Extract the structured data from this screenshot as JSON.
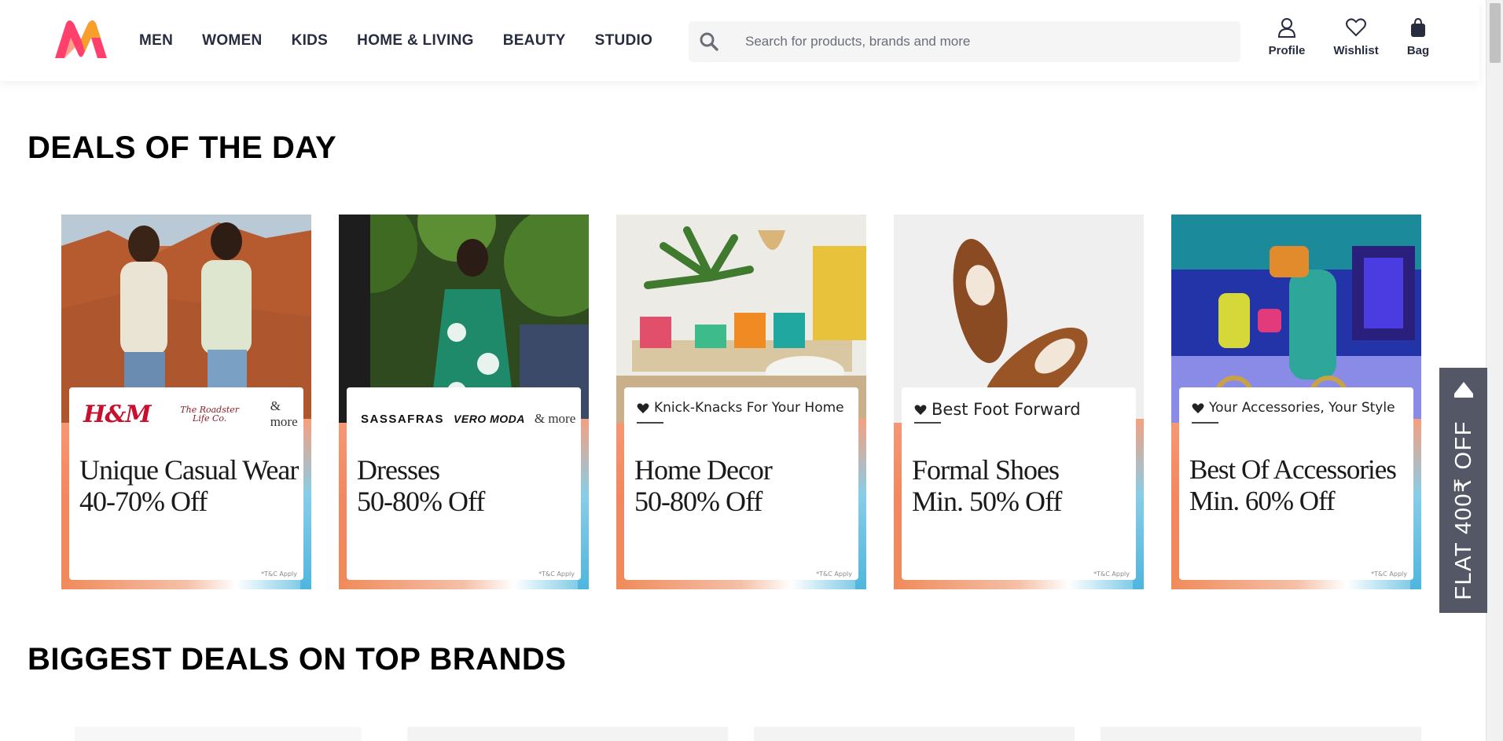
{
  "header": {
    "nav": [
      "MEN",
      "WOMEN",
      "KIDS",
      "HOME & LIVING",
      "BEAUTY",
      "STUDIO"
    ],
    "search_placeholder": "Search for products, brands and more",
    "actions": {
      "profile": "Profile",
      "wishlist": "Wishlist",
      "bag": "Bag"
    },
    "colors": {
      "logo_pink": "#ff3f6c",
      "logo_orange": "#f89f2b"
    }
  },
  "sections": {
    "deals_title": "DEALS OF THE DAY",
    "brands_title": "BIGGEST DEALS ON TOP BRANDS"
  },
  "deals": [
    {
      "brands": [
        "H&M",
        "The Roadster Life Co.",
        "& more"
      ],
      "title_line1": "Unique Casual Wear",
      "title_line2": "40-70% Off",
      "tnc": "*T&C Apply"
    },
    {
      "brands": [
        "SASSAFRAS",
        "VERO MODA",
        "& more"
      ],
      "title_line1": "Dresses",
      "title_line2": "50-80% Off",
      "tnc": "*T&C Apply"
    },
    {
      "tagline": "Knick-Knacks For Your Home",
      "title_line1": "Home Decor",
      "title_line2": "50-80% Off",
      "tnc": "*T&C Apply"
    },
    {
      "tagline": "Best Foot Forward",
      "title_line1": "Formal Shoes",
      "title_line2": "Min. 50% Off",
      "tnc": "*T&C Apply"
    },
    {
      "tagline": "Your Accessories, Your Style",
      "title_line1": "Best Of Accessories",
      "title_line2": "Min. 60% Off",
      "tnc": "*T&C Apply"
    }
  ],
  "flat_offer": {
    "text": "FLAT 400₹ OFF",
    "color": "#535766"
  }
}
